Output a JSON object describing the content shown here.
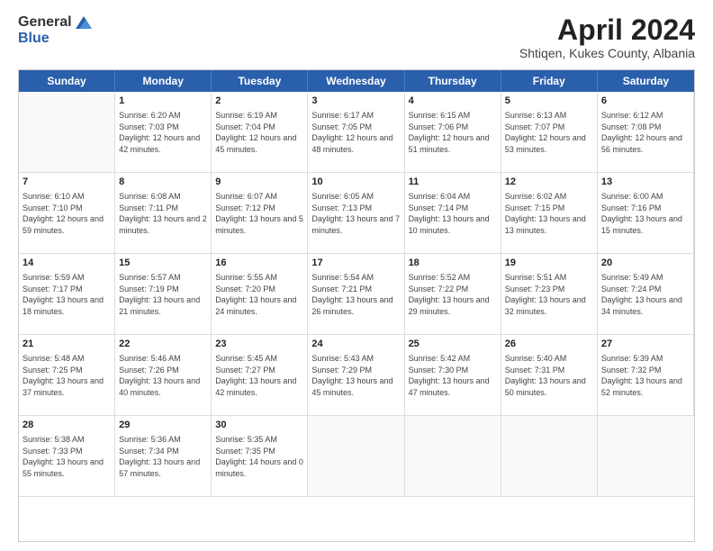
{
  "header": {
    "logo": {
      "general": "General",
      "blue": "Blue"
    },
    "title": "April 2024",
    "location": "Shtiqen, Kukes County, Albania"
  },
  "weekdays": [
    "Sunday",
    "Monday",
    "Tuesday",
    "Wednesday",
    "Thursday",
    "Friday",
    "Saturday"
  ],
  "weeks": [
    [
      {
        "day": "",
        "empty": true
      },
      {
        "day": "1",
        "sunrise": "Sunrise: 6:20 AM",
        "sunset": "Sunset: 7:03 PM",
        "daylight": "Daylight: 12 hours and 42 minutes."
      },
      {
        "day": "2",
        "sunrise": "Sunrise: 6:19 AM",
        "sunset": "Sunset: 7:04 PM",
        "daylight": "Daylight: 12 hours and 45 minutes."
      },
      {
        "day": "3",
        "sunrise": "Sunrise: 6:17 AM",
        "sunset": "Sunset: 7:05 PM",
        "daylight": "Daylight: 12 hours and 48 minutes."
      },
      {
        "day": "4",
        "sunrise": "Sunrise: 6:15 AM",
        "sunset": "Sunset: 7:06 PM",
        "daylight": "Daylight: 12 hours and 51 minutes."
      },
      {
        "day": "5",
        "sunrise": "Sunrise: 6:13 AM",
        "sunset": "Sunset: 7:07 PM",
        "daylight": "Daylight: 12 hours and 53 minutes."
      },
      {
        "day": "6",
        "sunrise": "Sunrise: 6:12 AM",
        "sunset": "Sunset: 7:08 PM",
        "daylight": "Daylight: 12 hours and 56 minutes."
      }
    ],
    [
      {
        "day": "7",
        "sunrise": "Sunrise: 6:10 AM",
        "sunset": "Sunset: 7:10 PM",
        "daylight": "Daylight: 12 hours and 59 minutes."
      },
      {
        "day": "8",
        "sunrise": "Sunrise: 6:08 AM",
        "sunset": "Sunset: 7:11 PM",
        "daylight": "Daylight: 13 hours and 2 minutes."
      },
      {
        "day": "9",
        "sunrise": "Sunrise: 6:07 AM",
        "sunset": "Sunset: 7:12 PM",
        "daylight": "Daylight: 13 hours and 5 minutes."
      },
      {
        "day": "10",
        "sunrise": "Sunrise: 6:05 AM",
        "sunset": "Sunset: 7:13 PM",
        "daylight": "Daylight: 13 hours and 7 minutes."
      },
      {
        "day": "11",
        "sunrise": "Sunrise: 6:04 AM",
        "sunset": "Sunset: 7:14 PM",
        "daylight": "Daylight: 13 hours and 10 minutes."
      },
      {
        "day": "12",
        "sunrise": "Sunrise: 6:02 AM",
        "sunset": "Sunset: 7:15 PM",
        "daylight": "Daylight: 13 hours and 13 minutes."
      },
      {
        "day": "13",
        "sunrise": "Sunrise: 6:00 AM",
        "sunset": "Sunset: 7:16 PM",
        "daylight": "Daylight: 13 hours and 15 minutes."
      }
    ],
    [
      {
        "day": "14",
        "sunrise": "Sunrise: 5:59 AM",
        "sunset": "Sunset: 7:17 PM",
        "daylight": "Daylight: 13 hours and 18 minutes."
      },
      {
        "day": "15",
        "sunrise": "Sunrise: 5:57 AM",
        "sunset": "Sunset: 7:19 PM",
        "daylight": "Daylight: 13 hours and 21 minutes."
      },
      {
        "day": "16",
        "sunrise": "Sunrise: 5:55 AM",
        "sunset": "Sunset: 7:20 PM",
        "daylight": "Daylight: 13 hours and 24 minutes."
      },
      {
        "day": "17",
        "sunrise": "Sunrise: 5:54 AM",
        "sunset": "Sunset: 7:21 PM",
        "daylight": "Daylight: 13 hours and 26 minutes."
      },
      {
        "day": "18",
        "sunrise": "Sunrise: 5:52 AM",
        "sunset": "Sunset: 7:22 PM",
        "daylight": "Daylight: 13 hours and 29 minutes."
      },
      {
        "day": "19",
        "sunrise": "Sunrise: 5:51 AM",
        "sunset": "Sunset: 7:23 PM",
        "daylight": "Daylight: 13 hours and 32 minutes."
      },
      {
        "day": "20",
        "sunrise": "Sunrise: 5:49 AM",
        "sunset": "Sunset: 7:24 PM",
        "daylight": "Daylight: 13 hours and 34 minutes."
      }
    ],
    [
      {
        "day": "21",
        "sunrise": "Sunrise: 5:48 AM",
        "sunset": "Sunset: 7:25 PM",
        "daylight": "Daylight: 13 hours and 37 minutes."
      },
      {
        "day": "22",
        "sunrise": "Sunrise: 5:46 AM",
        "sunset": "Sunset: 7:26 PM",
        "daylight": "Daylight: 13 hours and 40 minutes."
      },
      {
        "day": "23",
        "sunrise": "Sunrise: 5:45 AM",
        "sunset": "Sunset: 7:27 PM",
        "daylight": "Daylight: 13 hours and 42 minutes."
      },
      {
        "day": "24",
        "sunrise": "Sunrise: 5:43 AM",
        "sunset": "Sunset: 7:29 PM",
        "daylight": "Daylight: 13 hours and 45 minutes."
      },
      {
        "day": "25",
        "sunrise": "Sunrise: 5:42 AM",
        "sunset": "Sunset: 7:30 PM",
        "daylight": "Daylight: 13 hours and 47 minutes."
      },
      {
        "day": "26",
        "sunrise": "Sunrise: 5:40 AM",
        "sunset": "Sunset: 7:31 PM",
        "daylight": "Daylight: 13 hours and 50 minutes."
      },
      {
        "day": "27",
        "sunrise": "Sunrise: 5:39 AM",
        "sunset": "Sunset: 7:32 PM",
        "daylight": "Daylight: 13 hours and 52 minutes."
      }
    ],
    [
      {
        "day": "28",
        "sunrise": "Sunrise: 5:38 AM",
        "sunset": "Sunset: 7:33 PM",
        "daylight": "Daylight: 13 hours and 55 minutes."
      },
      {
        "day": "29",
        "sunrise": "Sunrise: 5:36 AM",
        "sunset": "Sunset: 7:34 PM",
        "daylight": "Daylight: 13 hours and 57 minutes."
      },
      {
        "day": "30",
        "sunrise": "Sunrise: 5:35 AM",
        "sunset": "Sunset: 7:35 PM",
        "daylight": "Daylight: 14 hours and 0 minutes."
      },
      {
        "day": "",
        "empty": true
      },
      {
        "day": "",
        "empty": true
      },
      {
        "day": "",
        "empty": true
      },
      {
        "day": "",
        "empty": true
      }
    ]
  ]
}
